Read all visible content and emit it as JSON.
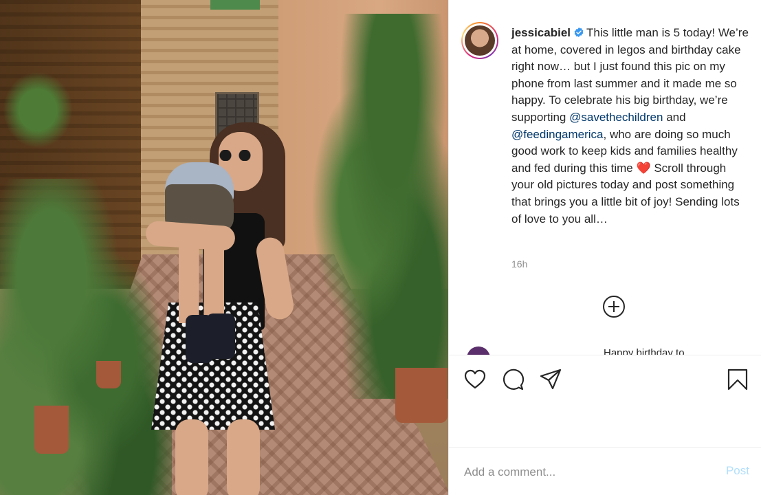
{
  "post": {
    "username": "jessicabiel",
    "caption_segments": {
      "p1": "This little man is 5 today! We’re at home, covered in legos and birthday cake right now… but I just found this pic on my phone from last summer and it made me so happy. To celebrate his big birthday, we’re supporting ",
      "m1": "@savethechildren",
      "p2": " and ",
      "m2": "@feedingamerica",
      "p3": ", who are doing so much good work to keep kids and families healthy and fed during this time ",
      "emoji": "❤️",
      "p4": "  Scroll through your old pictures today and post something that brings you a little bit of joy! Sending lots of love to you all…"
    },
    "timestamp": "16h",
    "next_comment_partial": "Happy birthday to"
  },
  "actions": {
    "like_icon": "heart-outline-icon",
    "comment_icon": "speech-bubble-icon",
    "share_icon": "paper-plane-icon",
    "save_icon": "bookmark-icon",
    "load_more_icon": "plus-circle-icon"
  },
  "comment_box": {
    "placeholder": "Add a comment...",
    "post_label": "Post"
  },
  "colors": {
    "mention": "#00376b",
    "verified": "#3897f0",
    "post_disabled": "#b2dffc",
    "timestamp": "#8e8e8e"
  }
}
